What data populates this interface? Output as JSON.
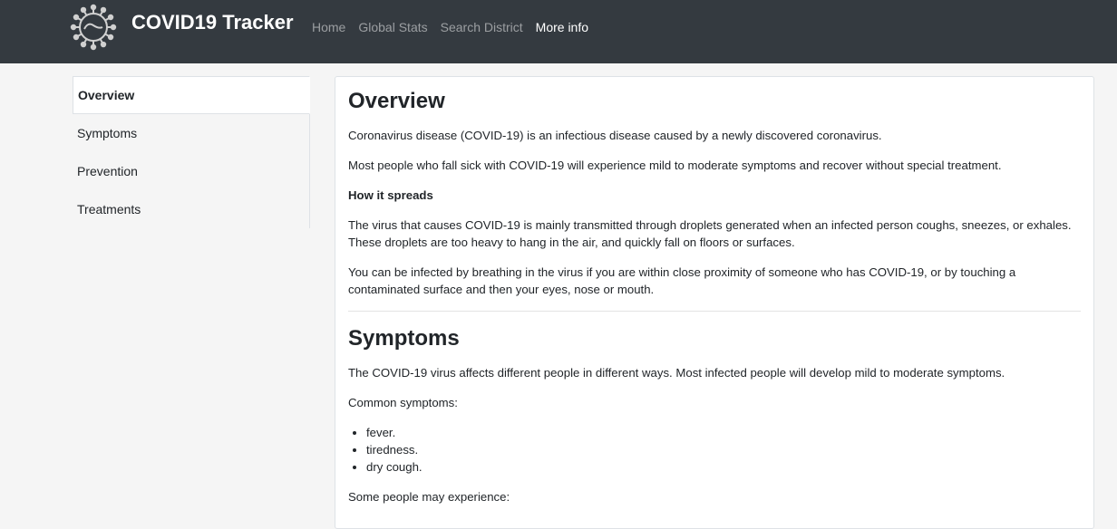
{
  "navbar": {
    "brand": "COVID19 Tracker",
    "links": [
      {
        "label": "Home"
      },
      {
        "label": "Global Stats"
      },
      {
        "label": "Search District"
      },
      {
        "label": "More info",
        "active": true
      }
    ],
    "logo_icon": "virus-icon"
  },
  "sidebar": {
    "items": [
      {
        "label": "Overview",
        "active": true
      },
      {
        "label": "Symptoms"
      },
      {
        "label": "Prevention"
      },
      {
        "label": "Treatments"
      }
    ]
  },
  "content": {
    "overview": {
      "heading": "Overview",
      "p1": "Coronavirus disease (COVID-19) is an infectious disease caused by a newly discovered coronavirus.",
      "p2": "Most people who fall sick with COVID-19 will experience mild to moderate symptoms and recover without special treatment.",
      "spread_heading": "How it spreads",
      "p3": "The virus that causes COVID-19 is mainly transmitted through droplets generated when an infected person coughs, sneezes, or exhales. These droplets are too heavy to hang in the air, and quickly fall on floors or surfaces.",
      "p4": "You can be infected by breathing in the virus if you are within close proximity of someone who has COVID-19, or by touching a contaminated surface and then your eyes, nose or mouth."
    },
    "symptoms": {
      "heading": "Symptoms",
      "p1": "The COVID-19 virus affects different people in different ways. Most infected people will develop mild to moderate symptoms.",
      "common_label": "Common symptoms:",
      "common": [
        "fever.",
        "tiredness.",
        "dry cough."
      ],
      "some_label": "Some people may experience:"
    }
  },
  "colors": {
    "navbar_bg": "#343a40",
    "page_bg": "#f5f5f5"
  }
}
